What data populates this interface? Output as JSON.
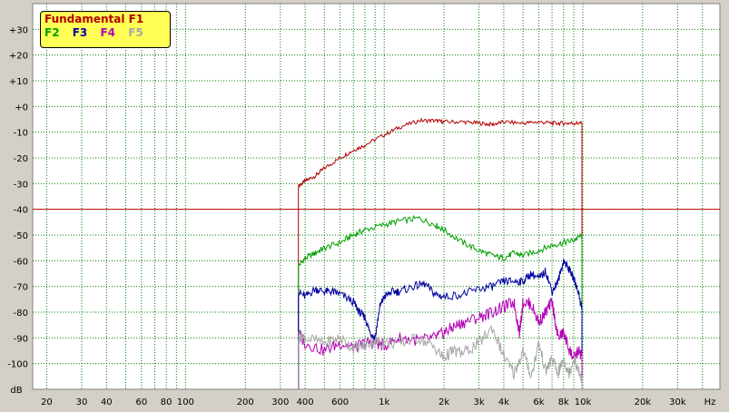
{
  "chart_data": {
    "type": "line",
    "ylabel": "dB",
    "xunit": "Hz",
    "x_scale": "log",
    "xlim": [
      17,
      49000
    ],
    "ylim": [
      -110,
      40
    ],
    "y_ticks": [
      {
        "v": 30,
        "label": "+30"
      },
      {
        "v": 20,
        "label": "+20"
      },
      {
        "v": 10,
        "label": "+10"
      },
      {
        "v": 0,
        "label": "+0"
      },
      {
        "v": -10,
        "label": "-10"
      },
      {
        "v": -20,
        "label": "-20"
      },
      {
        "v": -30,
        "label": "-30"
      },
      {
        "v": -40,
        "label": "-40"
      },
      {
        "v": -50,
        "label": "-50"
      },
      {
        "v": -60,
        "label": "-60"
      },
      {
        "v": -70,
        "label": "-70"
      },
      {
        "v": -80,
        "label": "-80"
      },
      {
        "v": -90,
        "label": "-90"
      },
      {
        "v": -100,
        "label": "-100"
      }
    ],
    "x_ticks": [
      {
        "v": 20,
        "label": "20"
      },
      {
        "v": 30,
        "label": "30"
      },
      {
        "v": 40,
        "label": "40"
      },
      {
        "v": 60,
        "label": "60"
      },
      {
        "v": 80,
        "label": "80"
      },
      {
        "v": 100,
        "label": "100"
      },
      {
        "v": 200,
        "label": "200"
      },
      {
        "v": 300,
        "label": "300"
      },
      {
        "v": 400,
        "label": "400"
      },
      {
        "v": 600,
        "label": "600"
      },
      {
        "v": 1000,
        "label": "1k"
      },
      {
        "v": 2000,
        "label": "2k"
      },
      {
        "v": 3000,
        "label": "3k"
      },
      {
        "v": 4000,
        "label": "4k"
      },
      {
        "v": 6000,
        "label": "6k"
      },
      {
        "v": 8000,
        "label": "8k"
      },
      {
        "v": 10000,
        "label": "10k"
      },
      {
        "v": 20000,
        "label": "20k"
      },
      {
        "v": 30000,
        "label": "30k"
      }
    ],
    "minor_grid_x": [
      20,
      30,
      40,
      50,
      60,
      70,
      80,
      90,
      100,
      200,
      300,
      400,
      500,
      600,
      700,
      800,
      900,
      1000,
      2000,
      3000,
      4000,
      5000,
      6000,
      7000,
      8000,
      9000,
      10000,
      20000,
      30000,
      40000
    ],
    "grid": true,
    "legend_position": "top-left",
    "reference_line": {
      "y": -40,
      "color": "#c80000"
    },
    "series": [
      {
        "name": "Fundamental F1",
        "color": "#b40000",
        "x": [
          370,
          400,
          450,
          500,
          600,
          700,
          800,
          1000,
          1200,
          1500,
          1800,
          2000,
          2500,
          3000,
          3500,
          4000,
          5000,
          6000,
          7000,
          8000,
          9000,
          9900
        ],
        "y": [
          -31,
          -29,
          -27,
          -24,
          -20,
          -17,
          -15,
          -11,
          -8,
          -5.5,
          -5.5,
          -6,
          -6,
          -6.5,
          -7,
          -6,
          -6.5,
          -6,
          -6.5,
          -6.5,
          -6.5,
          -6.5
        ]
      },
      {
        "name": "F2",
        "color": "#00a000",
        "x": [
          370,
          400,
          450,
          500,
          600,
          700,
          800,
          1000,
          1200,
          1500,
          1800,
          2000,
          2500,
          3000,
          3500,
          4000,
          4500,
          5000,
          6000,
          7000,
          8000,
          9000,
          9900
        ],
        "y": [
          -62,
          -59,
          -57,
          -55,
          -53,
          -50,
          -48,
          -46,
          -44.5,
          -43.5,
          -46,
          -48,
          -53,
          -56,
          -58,
          -59,
          -57,
          -58,
          -56,
          -54,
          -53,
          -52,
          -50
        ]
      },
      {
        "name": "F3",
        "color": "#0000a0",
        "x": [
          370,
          400,
          450,
          500,
          550,
          600,
          700,
          750,
          800,
          850,
          900,
          950,
          1000,
          1100,
          1200,
          1400,
          1600,
          1800,
          2000,
          2500,
          3000,
          3500,
          4000,
          4500,
          5000,
          5500,
          6000,
          6500,
          7000,
          7500,
          8000,
          8500,
          9000,
          9500,
          9900
        ],
        "y": [
          -72,
          -74,
          -71,
          -72,
          -72,
          -73,
          -76,
          -80,
          -82,
          -88,
          -90,
          -78,
          -74,
          -72,
          -72,
          -70,
          -69,
          -73,
          -74,
          -73,
          -71,
          -70,
          -68,
          -68,
          -68,
          -65,
          -67,
          -64,
          -72,
          -68,
          -60,
          -63,
          -67,
          -72,
          -79
        ]
      },
      {
        "name": "F4",
        "color": "#b400b4",
        "x": [
          370,
          400,
          500,
          600,
          700,
          800,
          900,
          1000,
          1200,
          1500,
          1800,
          2000,
          2200,
          2500,
          3000,
          3500,
          4000,
          4500,
          4800,
          5000,
          5500,
          6000,
          6500,
          7000,
          7500,
          8000,
          8500,
          9000,
          9500,
          9900
        ],
        "y": [
          -88,
          -92,
          -95,
          -92,
          -94,
          -92,
          -92,
          -93,
          -90,
          -91,
          -90,
          -88,
          -86,
          -84,
          -82,
          -80,
          -78,
          -76,
          -88,
          -76,
          -77,
          -84,
          -80,
          -76,
          -90,
          -88,
          -94,
          -98,
          -95,
          -97
        ]
      },
      {
        "name": "F5",
        "color": "#a8a8a8",
        "x": [
          370,
          400,
          500,
          600,
          700,
          800,
          900,
          1000,
          1200,
          1500,
          1800,
          2000,
          2200,
          2500,
          3000,
          3500,
          4000,
          4500,
          5000,
          5500,
          6000,
          6500,
          7000,
          7500,
          8000,
          8500,
          9000,
          9500,
          9900
        ],
        "y": [
          -89,
          -90,
          -92,
          -90,
          -94,
          -93,
          -91,
          -92,
          -92,
          -90,
          -94,
          -98,
          -95,
          -96,
          -92,
          -86,
          -97,
          -104,
          -95,
          -105,
          -92,
          -103,
          -98,
          -104,
          -98,
          -104,
          -98,
          -103,
          -106
        ]
      }
    ]
  },
  "legend": {
    "f1": "Fundamental F1",
    "f2": "F2",
    "f3": "F3",
    "f4": "F4",
    "f5": "F5"
  },
  "colors": {
    "background": "#d4d0c8",
    "plot_area": "#ffffff",
    "grid": "#008000",
    "legend_bg": "#ffff55"
  }
}
